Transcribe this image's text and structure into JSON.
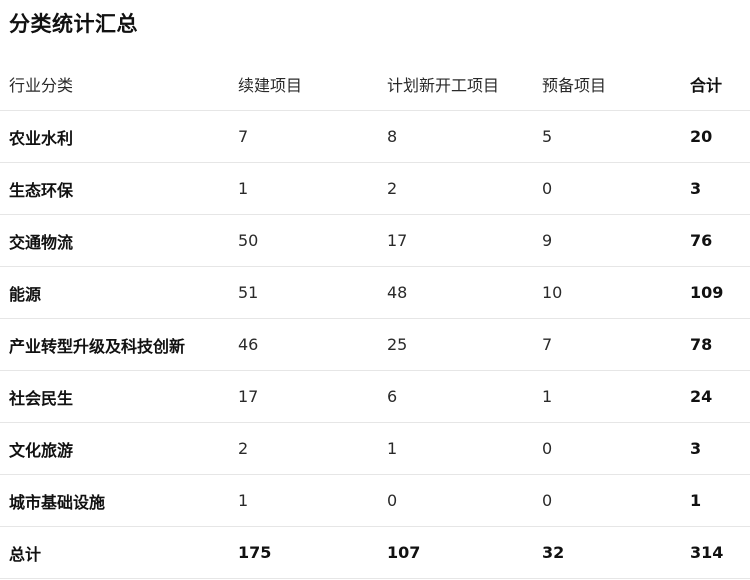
{
  "title": "分类统计汇总",
  "table": {
    "headers": [
      "行业分类",
      "续建项目",
      "计划新开工项目",
      "预备项目",
      "合计"
    ],
    "rows": [
      {
        "category": "农业水利",
        "continuing": "7",
        "planned_new": "8",
        "reserve": "5",
        "total": "20"
      },
      {
        "category": "生态环保",
        "continuing": "1",
        "planned_new": "2",
        "reserve": "0",
        "total": "3"
      },
      {
        "category": "交通物流",
        "continuing": "50",
        "planned_new": "17",
        "reserve": "9",
        "total": "76"
      },
      {
        "category": "能源",
        "continuing": "51",
        "planned_new": "48",
        "reserve": "10",
        "total": "109"
      },
      {
        "category": "产业转型升级及科技创新",
        "continuing": "46",
        "planned_new": "25",
        "reserve": "7",
        "total": "78"
      },
      {
        "category": "社会民生",
        "continuing": "17",
        "planned_new": "6",
        "reserve": "1",
        "total": "24"
      },
      {
        "category": "文化旅游",
        "continuing": "2",
        "planned_new": "1",
        "reserve": "0",
        "total": "3"
      },
      {
        "category": "城市基础设施",
        "continuing": "1",
        "planned_new": "0",
        "reserve": "0",
        "total": "1"
      }
    ],
    "grand_total": {
      "category": "总计",
      "continuing": "175",
      "planned_new": "107",
      "reserve": "32",
      "total": "314"
    }
  }
}
